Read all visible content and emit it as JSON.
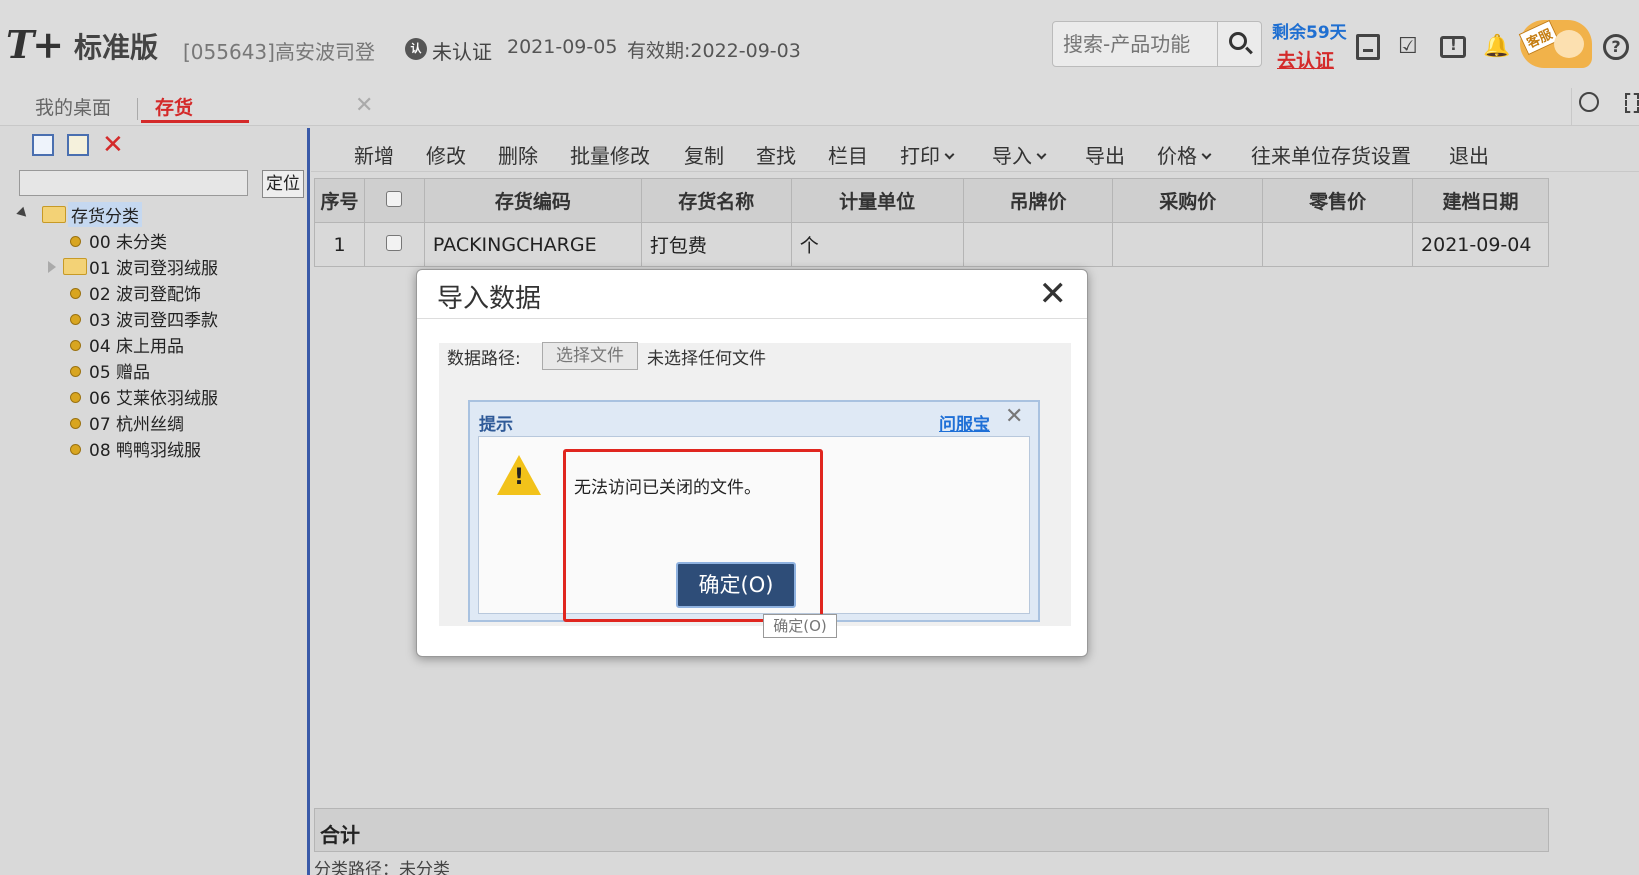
{
  "header": {
    "logo": "T+",
    "edition": "标准版",
    "company": "[055643]高安波司登",
    "auth_status": "未认证",
    "date": "2021-09-05",
    "valid": "有效期:2022-09-03",
    "search_placeholder": "搜索-产品功能",
    "remaining": "剩余59天",
    "go_auth": "去认证",
    "kefu": "客服"
  },
  "tabs": {
    "desktop": "我的桌面",
    "active": "存货"
  },
  "left": {
    "locate_btn": "定位",
    "root": "存货分类",
    "nodes": [
      "00 未分类",
      "01 波司登羽绒服",
      "02 波司登配饰",
      "03 波司登四季款",
      "04 床上用品",
      "05 赠品",
      "06 艾莱依羽绒服",
      "07 杭州丝绸",
      "08 鸭鸭羽绒服"
    ]
  },
  "toolbar": {
    "add": "新增",
    "edit": "修改",
    "delete": "删除",
    "batch_edit": "批量修改",
    "copy": "复制",
    "find": "查找",
    "columns": "栏目",
    "print": "打印",
    "import": "导入",
    "export": "导出",
    "price": "价格",
    "partner_settings": "往来单位存货设置",
    "exit": "退出"
  },
  "grid": {
    "headers": [
      "序号",
      "",
      "存货编码",
      "存货名称",
      "计量单位",
      "吊牌价",
      "采购价",
      "零售价",
      "建档日期"
    ],
    "rows": [
      [
        "1",
        "",
        "PACKINGCHARGE",
        "打包费",
        "个",
        "",
        "",
        "",
        "2021-09-04"
      ]
    ],
    "sum_label": "合计"
  },
  "status": {
    "path": "分类路径：未分类"
  },
  "modal": {
    "title": "导入数据",
    "path_label": "数据路径:",
    "file_btn": "选择文件",
    "file_none": "未选择任何文件"
  },
  "alert": {
    "title": "提示",
    "help_link": "问服宝",
    "message": "无法访问已关闭的文件。",
    "ok": "确定(O)",
    "tooltip": "确定(O)"
  }
}
